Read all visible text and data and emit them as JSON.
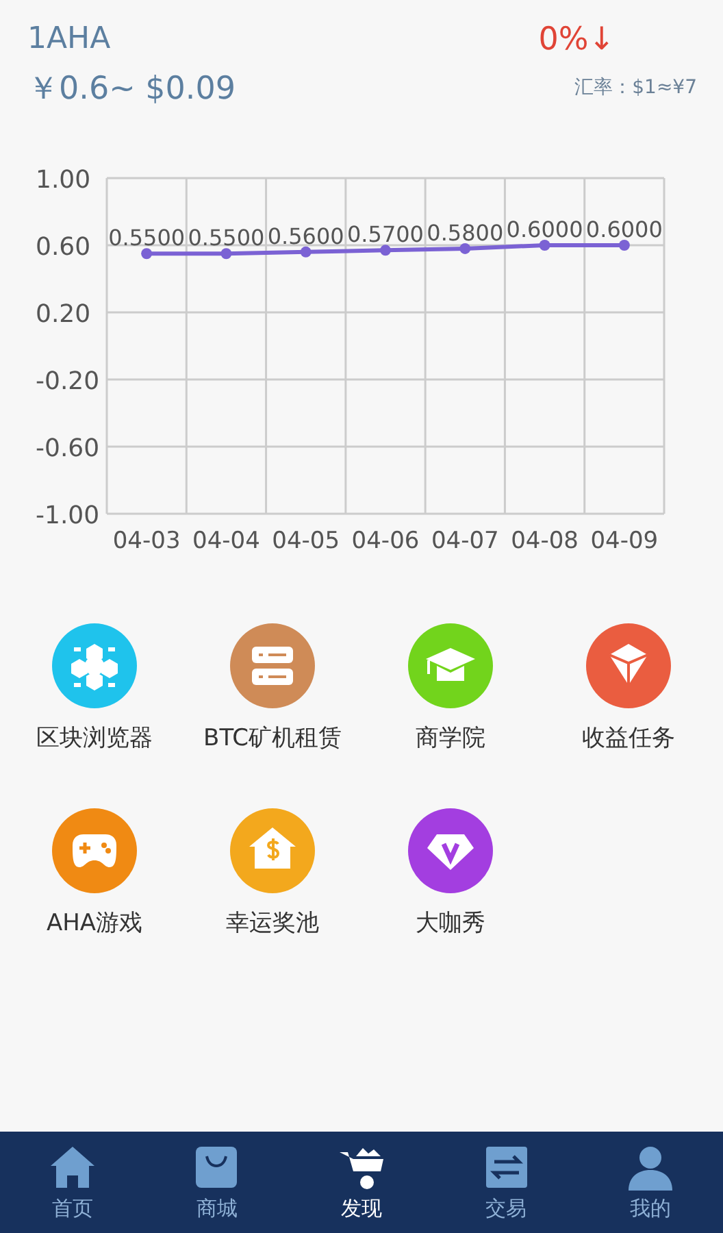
{
  "header": {
    "coin": "1AHA",
    "price": "￥0.6~ $0.09",
    "change": "0%↓",
    "rate": "汇率：$1≈¥7"
  },
  "chart_data": {
    "type": "line",
    "categories": [
      "04-03",
      "04-04",
      "04-05",
      "04-06",
      "04-07",
      "04-08",
      "04-09"
    ],
    "ylim": [
      -1,
      1
    ],
    "yticks": [
      {
        "value": 1,
        "label": "1.00"
      },
      {
        "value": 0.6,
        "label": "0.60"
      },
      {
        "value": 0.2,
        "label": "0.20"
      },
      {
        "value": -0.2,
        "label": "-0.20"
      },
      {
        "value": -0.6,
        "label": "-0.60"
      },
      {
        "value": -1,
        "label": "-1.00"
      }
    ],
    "grid": true,
    "series": [
      {
        "color": "#7b62d4",
        "marker": "circle",
        "values": [
          0.55,
          0.55,
          0.56,
          0.57,
          0.58,
          0.6,
          0.6
        ],
        "value_labels": [
          "0.5500",
          "0.5500",
          "0.5600",
          "0.5700",
          "0.5800",
          "0.6000",
          "0.6000"
        ]
      }
    ]
  },
  "features": [
    {
      "label": "区块浏览器",
      "color": "#1fc3ec"
    },
    {
      "label": "BTC矿机租赁",
      "color": "#cf8b57"
    },
    {
      "label": "商学院",
      "color": "#72d41c"
    },
    {
      "label": "收益任务",
      "color": "#ea5d40"
    },
    {
      "label": "AHA游戏",
      "color": "#f08a13"
    },
    {
      "label": "幸运奖池",
      "color": "#f3a81d"
    },
    {
      "label": "大咖秀",
      "color": "#a33ee0"
    }
  ],
  "nav": [
    {
      "label": "首页",
      "selected": false
    },
    {
      "label": "商城",
      "selected": false
    },
    {
      "label": "发现",
      "selected": true
    },
    {
      "label": "交易",
      "selected": false
    },
    {
      "label": "我的",
      "selected": false
    }
  ]
}
